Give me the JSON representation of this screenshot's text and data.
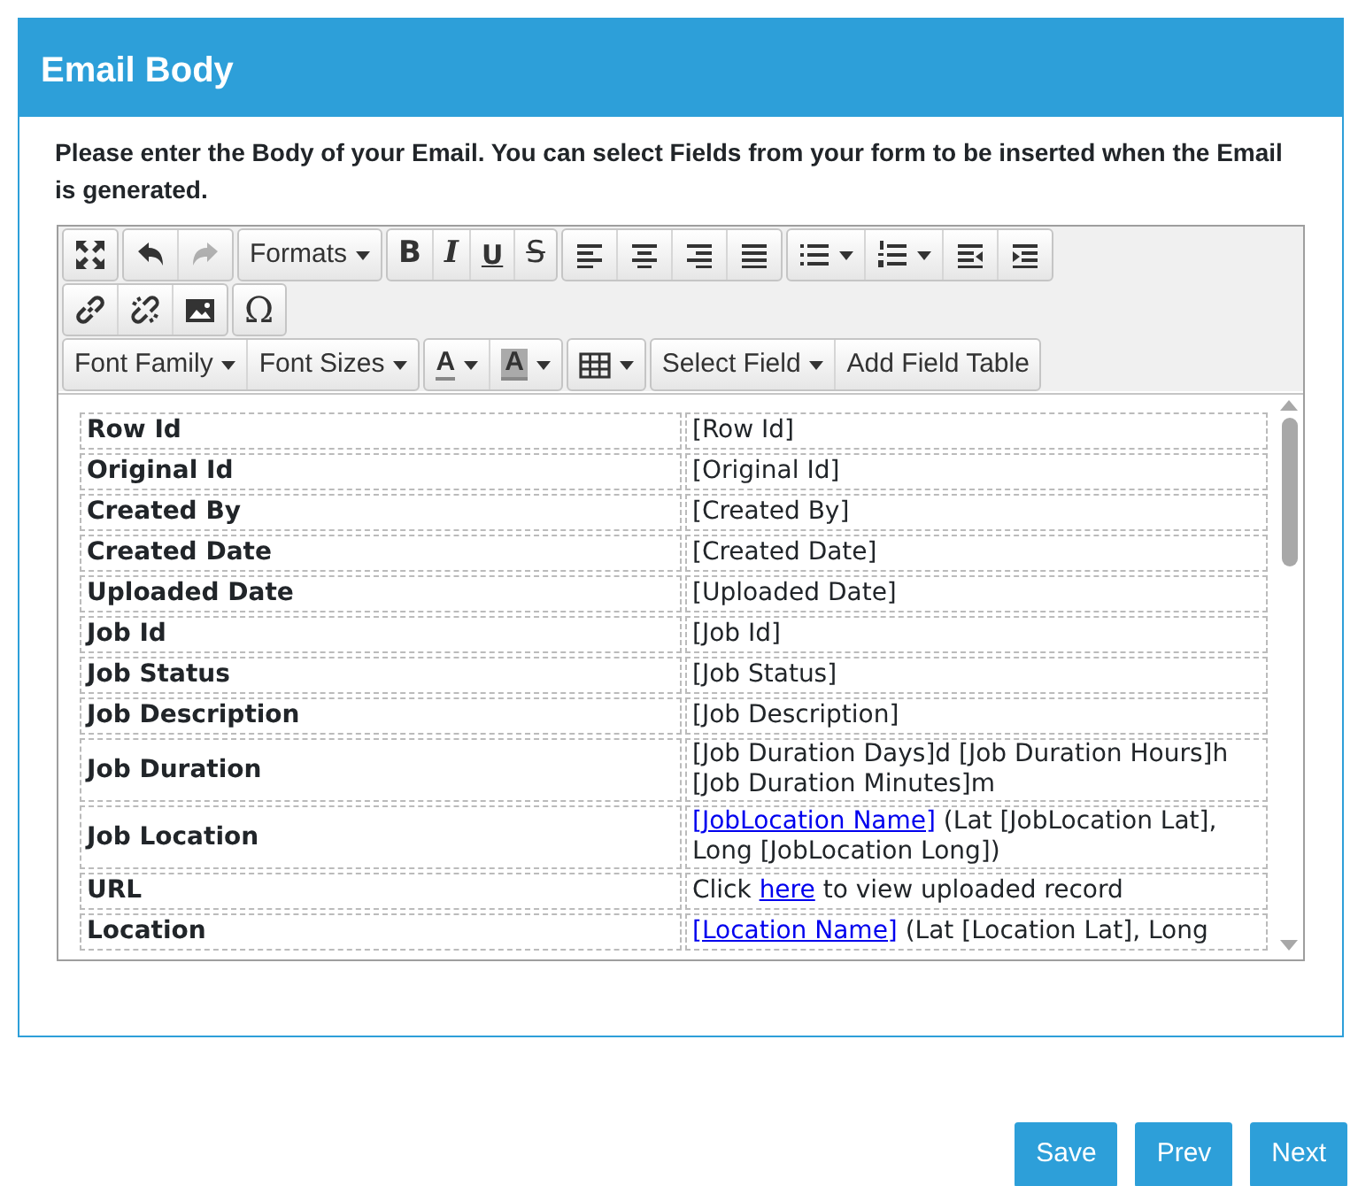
{
  "panel": {
    "title": "Email Body",
    "instructions": "Please enter the Body of your Email. You can select Fields from your form to be inserted when the Email is generated."
  },
  "toolbar": [
    [
      [
        {
          "kind": "icon"
        }
      ],
      [
        {
          "kind": "icon"
        },
        {
          "kind": "icon",
          "disabled": true
        }
      ],
      [
        {
          "kind": "text",
          "label": "Formats",
          "dropdown": true
        }
      ],
      [
        {
          "kind": "glyph",
          "label": "B"
        },
        {
          "kind": "glyph",
          "label": "I"
        },
        {
          "kind": "glyph",
          "label": "U"
        },
        {
          "kind": "glyph",
          "label": "S"
        }
      ],
      [
        {
          "kind": "icon"
        },
        {
          "kind": "icon"
        },
        {
          "kind": "icon"
        },
        {
          "kind": "icon"
        }
      ],
      [
        {
          "kind": "icon",
          "dropdown": true
        },
        {
          "kind": "icon",
          "dropdown": true
        },
        {
          "kind": "icon"
        },
        {
          "kind": "icon"
        }
      ]
    ],
    [
      [
        {
          "kind": "icon"
        },
        {
          "kind": "icon"
        },
        {
          "kind": "icon"
        }
      ],
      [
        {
          "kind": "glyph",
          "label": "Ω"
        }
      ]
    ],
    [
      [
        {
          "kind": "text",
          "label": "Font Family",
          "dropdown": true
        },
        {
          "kind": "text",
          "label": "Font Sizes",
          "dropdown": true
        }
      ],
      [
        {
          "kind": "glyph",
          "label": "A",
          "dropdown": true
        },
        {
          "kind": "glyph",
          "label": "A",
          "dropdown": true
        }
      ],
      [
        {
          "kind": "icon",
          "dropdown": true
        }
      ],
      [
        {
          "kind": "text",
          "label": "Select Field",
          "dropdown": true
        },
        {
          "kind": "text",
          "label": "Add Field Table"
        }
      ]
    ]
  ],
  "rows": [
    {
      "label": "Row Id",
      "value": [
        {
          "text": "[Row Id]"
        }
      ]
    },
    {
      "label": "Original Id",
      "value": [
        {
          "text": "[Original Id]"
        }
      ]
    },
    {
      "label": "Created By",
      "value": [
        {
          "text": "[Created By]"
        }
      ]
    },
    {
      "label": "Created Date",
      "value": [
        {
          "text": "[Created Date]"
        }
      ]
    },
    {
      "label": "Uploaded Date",
      "value": [
        {
          "text": "[Uploaded Date]"
        }
      ]
    },
    {
      "label": "Job Id",
      "value": [
        {
          "text": "[Job Id]"
        }
      ]
    },
    {
      "label": "Job Status",
      "value": [
        {
          "text": "[Job Status]"
        }
      ]
    },
    {
      "label": "Job Description",
      "value": [
        {
          "text": "[Job Description]"
        }
      ]
    },
    {
      "label": "Job Duration",
      "value": [
        {
          "text": "[Job Duration Days]d [Job Duration Hours]h [Job Duration Minutes]m"
        }
      ]
    },
    {
      "label": "Job Location",
      "value": [
        {
          "text": "[JobLocation Name]",
          "link": true
        },
        {
          "text": " (Lat [JobLocation Lat], Long [JobLocation Long])"
        }
      ]
    },
    {
      "label": "URL",
      "value": [
        {
          "text": "Click "
        },
        {
          "text": "here",
          "link": true
        },
        {
          "text": " to view uploaded record"
        }
      ]
    },
    {
      "label": "Location",
      "value": [
        {
          "text": "[Location Name]",
          "link": true
        },
        {
          "text": " (Lat [Location Lat], Long"
        }
      ]
    }
  ],
  "buttons": [
    "Save",
    "Prev",
    "Next"
  ]
}
